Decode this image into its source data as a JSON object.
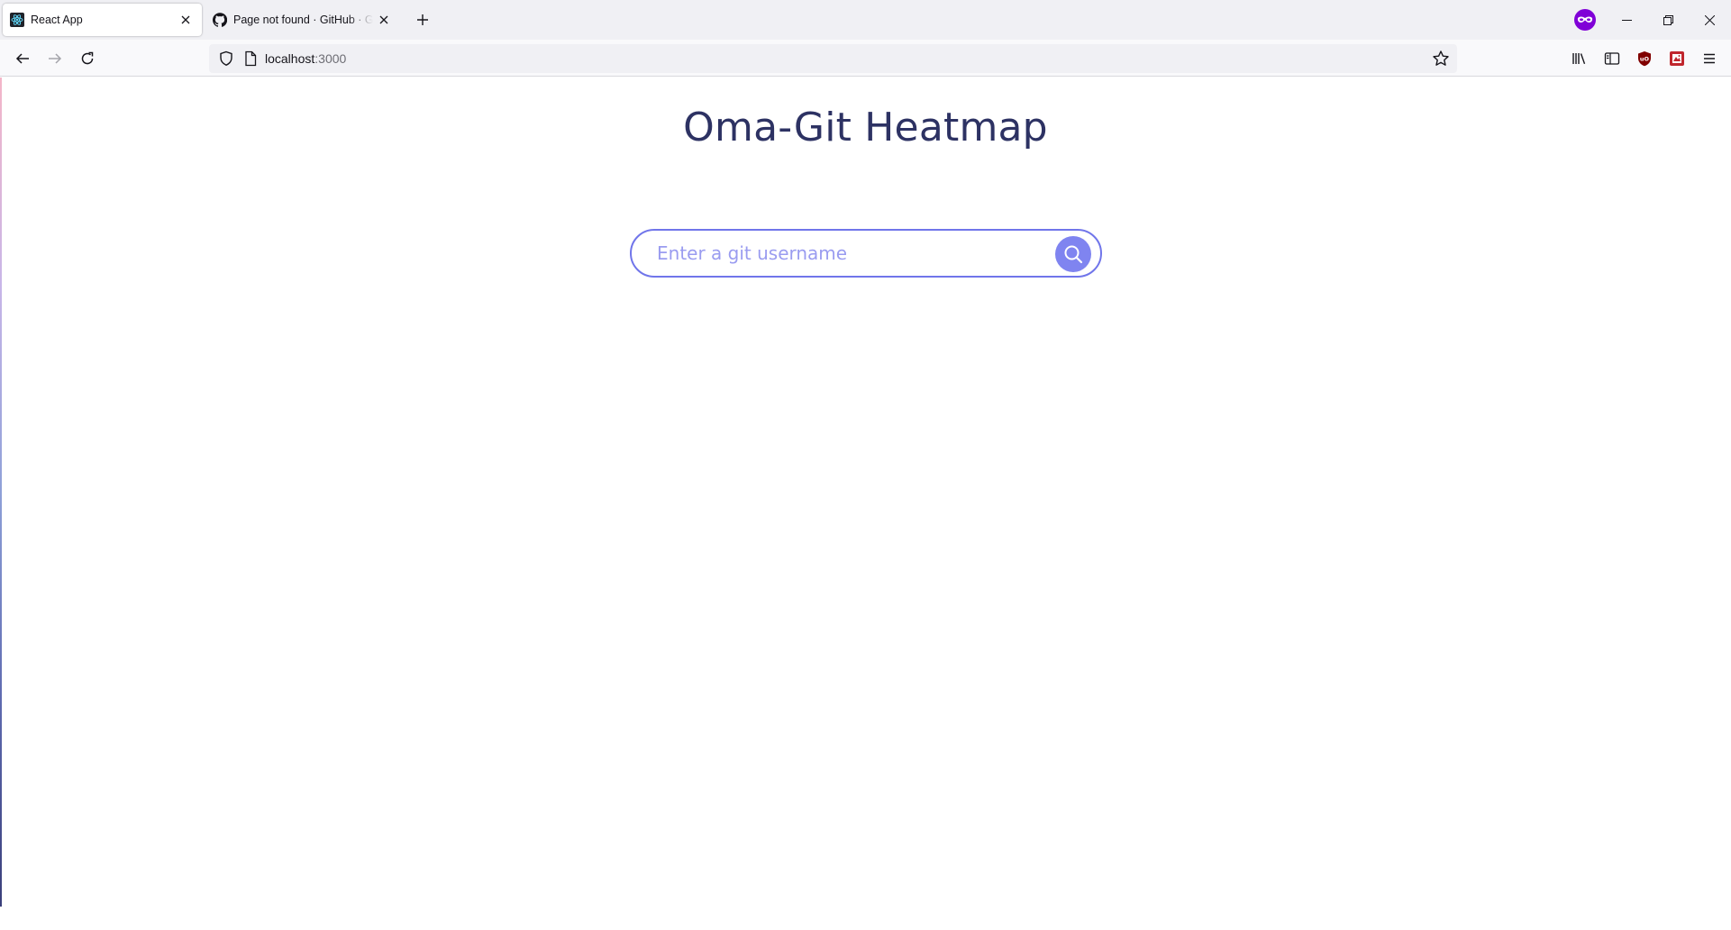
{
  "browser": {
    "tabs": [
      {
        "title": "React App",
        "active": true,
        "favicon": "react-icon"
      },
      {
        "title": "Page not found · GitHub · GitHub",
        "active": false,
        "favicon": "github-icon"
      }
    ],
    "url": {
      "host": "localhost",
      "port": ":3000"
    },
    "private_icon": "private-browsing-icon",
    "toolbar_icons": [
      "library-icon",
      "sidebar-icon",
      "ublock-icon",
      "extension-icon",
      "menu-icon"
    ]
  },
  "page": {
    "title": "Oma-Git Heatmap",
    "search": {
      "placeholder": "Enter a git username",
      "value": "",
      "button_icon": "search-icon"
    }
  },
  "colors": {
    "title": "#2d3263",
    "accent": "#7075ea",
    "button": "#7f84f0",
    "placeholder": "#9a9cf0"
  }
}
